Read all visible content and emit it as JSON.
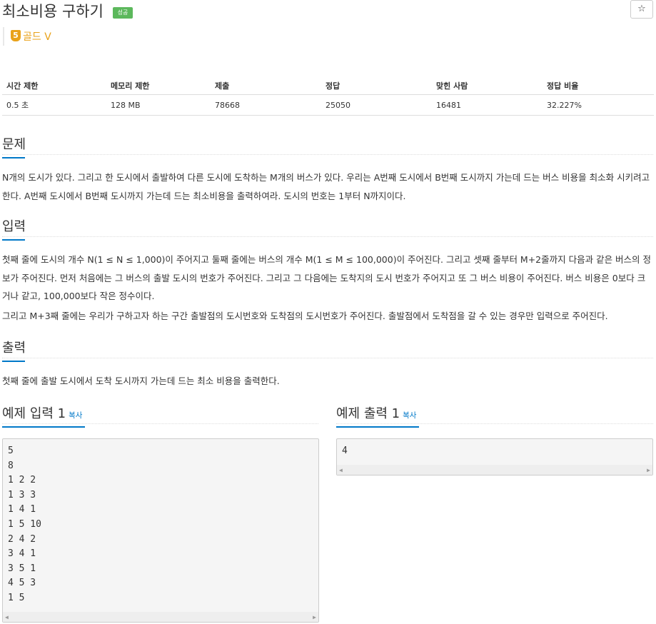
{
  "problem": {
    "title": "최소비용 구하기",
    "status_badge": "성공",
    "tier": {
      "number": "5",
      "label": "골드 V"
    },
    "star_icon": "☆"
  },
  "info_table": {
    "headers": [
      "시간 제한",
      "메모리 제한",
      "제출",
      "정답",
      "맞힌 사람",
      "정답 비율"
    ],
    "values": [
      "0.5 초",
      "128 MB",
      "78668",
      "25050",
      "16481",
      "32.227%"
    ]
  },
  "sections": {
    "description": {
      "heading": "문제",
      "text": "N개의 도시가 있다. 그리고 한 도시에서 출발하여 다른 도시에 도착하는 M개의 버스가 있다. 우리는 A번째 도시에서 B번째 도시까지 가는데 드는 버스 비용을 최소화 시키려고 한다. A번째 도시에서 B번째 도시까지 가는데 드는 최소비용을 출력하여라. 도시의 번호는 1부터 N까지이다."
    },
    "input": {
      "heading": "입력",
      "text1": "첫째 줄에 도시의 개수 N(1 ≤ N ≤ 1,000)이 주어지고 둘째 줄에는 버스의 개수 M(1 ≤ M ≤ 100,000)이 주어진다. 그리고 셋째 줄부터 M+2줄까지 다음과 같은 버스의 정보가 주어진다. 먼저 처음에는 그 버스의 출발 도시의 번호가 주어진다. 그리고 그 다음에는 도착지의 도시 번호가 주어지고 또 그 버스 비용이 주어진다. 버스 비용은 0보다 크거나 같고, 100,000보다 작은 정수이다.",
      "text2": "그리고 M+3째 줄에는 우리가 구하고자 하는 구간 출발점의 도시번호와 도착점의 도시번호가 주어진다. 출발점에서 도착점을 갈 수 있는 경우만 입력으로 주어진다."
    },
    "output": {
      "heading": "출력",
      "text": "첫째 줄에 출발 도시에서 도착 도시까지 가는데 드는 최소 비용을 출력한다."
    }
  },
  "samples": {
    "input": {
      "heading": "예제 입력 1",
      "copy": "복사",
      "lines": [
        "5",
        "8",
        "1 2 2",
        "1 3 3",
        "1 4 1",
        "1 5 10",
        "2 4 2",
        "3 4 1",
        "3 5 1",
        "4 5 3",
        "1 5"
      ]
    },
    "output": {
      "heading": "예제 출력 1",
      "copy": "복사",
      "lines": [
        "4"
      ]
    }
  }
}
